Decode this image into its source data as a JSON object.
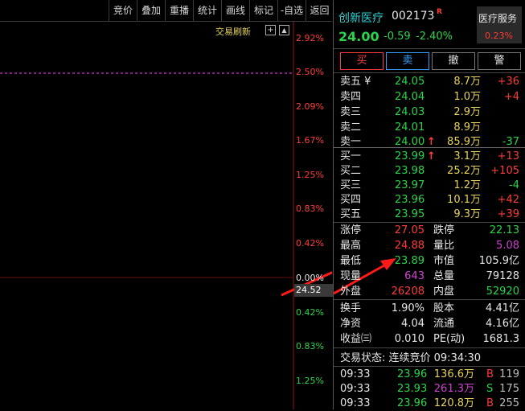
{
  "toolbar": {
    "buttons": [
      "竞价",
      "叠加",
      "重播",
      "统计",
      "画线",
      "标记",
      "-自选",
      "返回"
    ]
  },
  "chart": {
    "refresh_label": "交易刷新",
    "price_tag": "24.52",
    "pct_labels": [
      "2.92%",
      "2.50%",
      "2.09%",
      "1.67%",
      "1.25%",
      "0.83%",
      "0.42%",
      "0.00%",
      "0.42%",
      "0.83%",
      "1.25%"
    ],
    "colors": {
      "up": "#ff3b3b",
      "down": "#2bd44a",
      "avg": "#ff40ff"
    }
  },
  "stock": {
    "name": "创新医疗",
    "code": "002173",
    "flag": "R",
    "price": "24.00",
    "change": "-0.59",
    "change_pct": "-2.40%",
    "sector_name": "医疗服务",
    "sector_pct": "0.23%"
  },
  "actions": {
    "buy": "买",
    "sell": "卖",
    "cancel": "撤",
    "alert": "警"
  },
  "asks": [
    {
      "label": "卖五 ¥",
      "price": "24.05",
      "vol": "8.7万",
      "delta": "+36"
    },
    {
      "label": "卖四",
      "price": "24.04",
      "vol": "1.0万",
      "delta": "+4"
    },
    {
      "label": "卖三",
      "price": "24.03",
      "vol": "2.9万",
      "delta": ""
    },
    {
      "label": "卖二",
      "price": "24.01",
      "vol": "8.9万",
      "delta": ""
    },
    {
      "label": "卖一",
      "price": "24.00",
      "vol": "85.9万",
      "delta": "-37",
      "arrow": "↑"
    }
  ],
  "bids": [
    {
      "label": "买一",
      "price": "23.99",
      "vol": "3.1万",
      "delta": "+13",
      "arrow": "↑"
    },
    {
      "label": "买二",
      "price": "23.98",
      "vol": "25.2万",
      "delta": "+105"
    },
    {
      "label": "买三",
      "price": "23.97",
      "vol": "1.2万",
      "delta": "-4"
    },
    {
      "label": "买四",
      "price": "23.96",
      "vol": "10.1万",
      "delta": "+42"
    },
    {
      "label": "买五",
      "price": "23.95",
      "vol": "9.3万",
      "delta": "+39"
    }
  ],
  "stats": {
    "limit_up_label": "涨停",
    "limit_up": "27.05",
    "limit_down_label": "跌停",
    "limit_down": "22.13",
    "high_label": "最高",
    "high": "24.88",
    "ratio_label": "量比",
    "ratio": "5.08",
    "low_label": "最低",
    "low": "23.89",
    "mktcap_label": "市值",
    "mktcap": "105.9亿",
    "cur_vol_label": "现量",
    "cur_vol": "643",
    "total_vol_label": "总量",
    "total_vol": "79128",
    "outer_label": "外盘",
    "outer": "26208",
    "inner_label": "内盘",
    "inner": "52920",
    "turnover_label": "换手",
    "turnover": "1.90%",
    "equity_label": "股本",
    "equity": "4.41亿",
    "nav_label": "净资",
    "nav": "4.04",
    "float_label": "流通",
    "float": "4.16亿",
    "eps_label": "收益㈢",
    "eps": "0.010",
    "pe_label": "PE(动)",
    "pe": "1681.3"
  },
  "trade_status": "交易状态: 连续竞价 09:34:30",
  "ticks": [
    {
      "time": "09:33",
      "price": "23.96",
      "vol": "136.6万",
      "side": "B",
      "count": "119"
    },
    {
      "time": "09:33",
      "price": "23.93",
      "vol": "261.3万",
      "side": "S",
      "count": "175"
    },
    {
      "time": "09:33",
      "price": "23.96",
      "vol": "120.8万",
      "side": "B",
      "count": "255"
    }
  ]
}
